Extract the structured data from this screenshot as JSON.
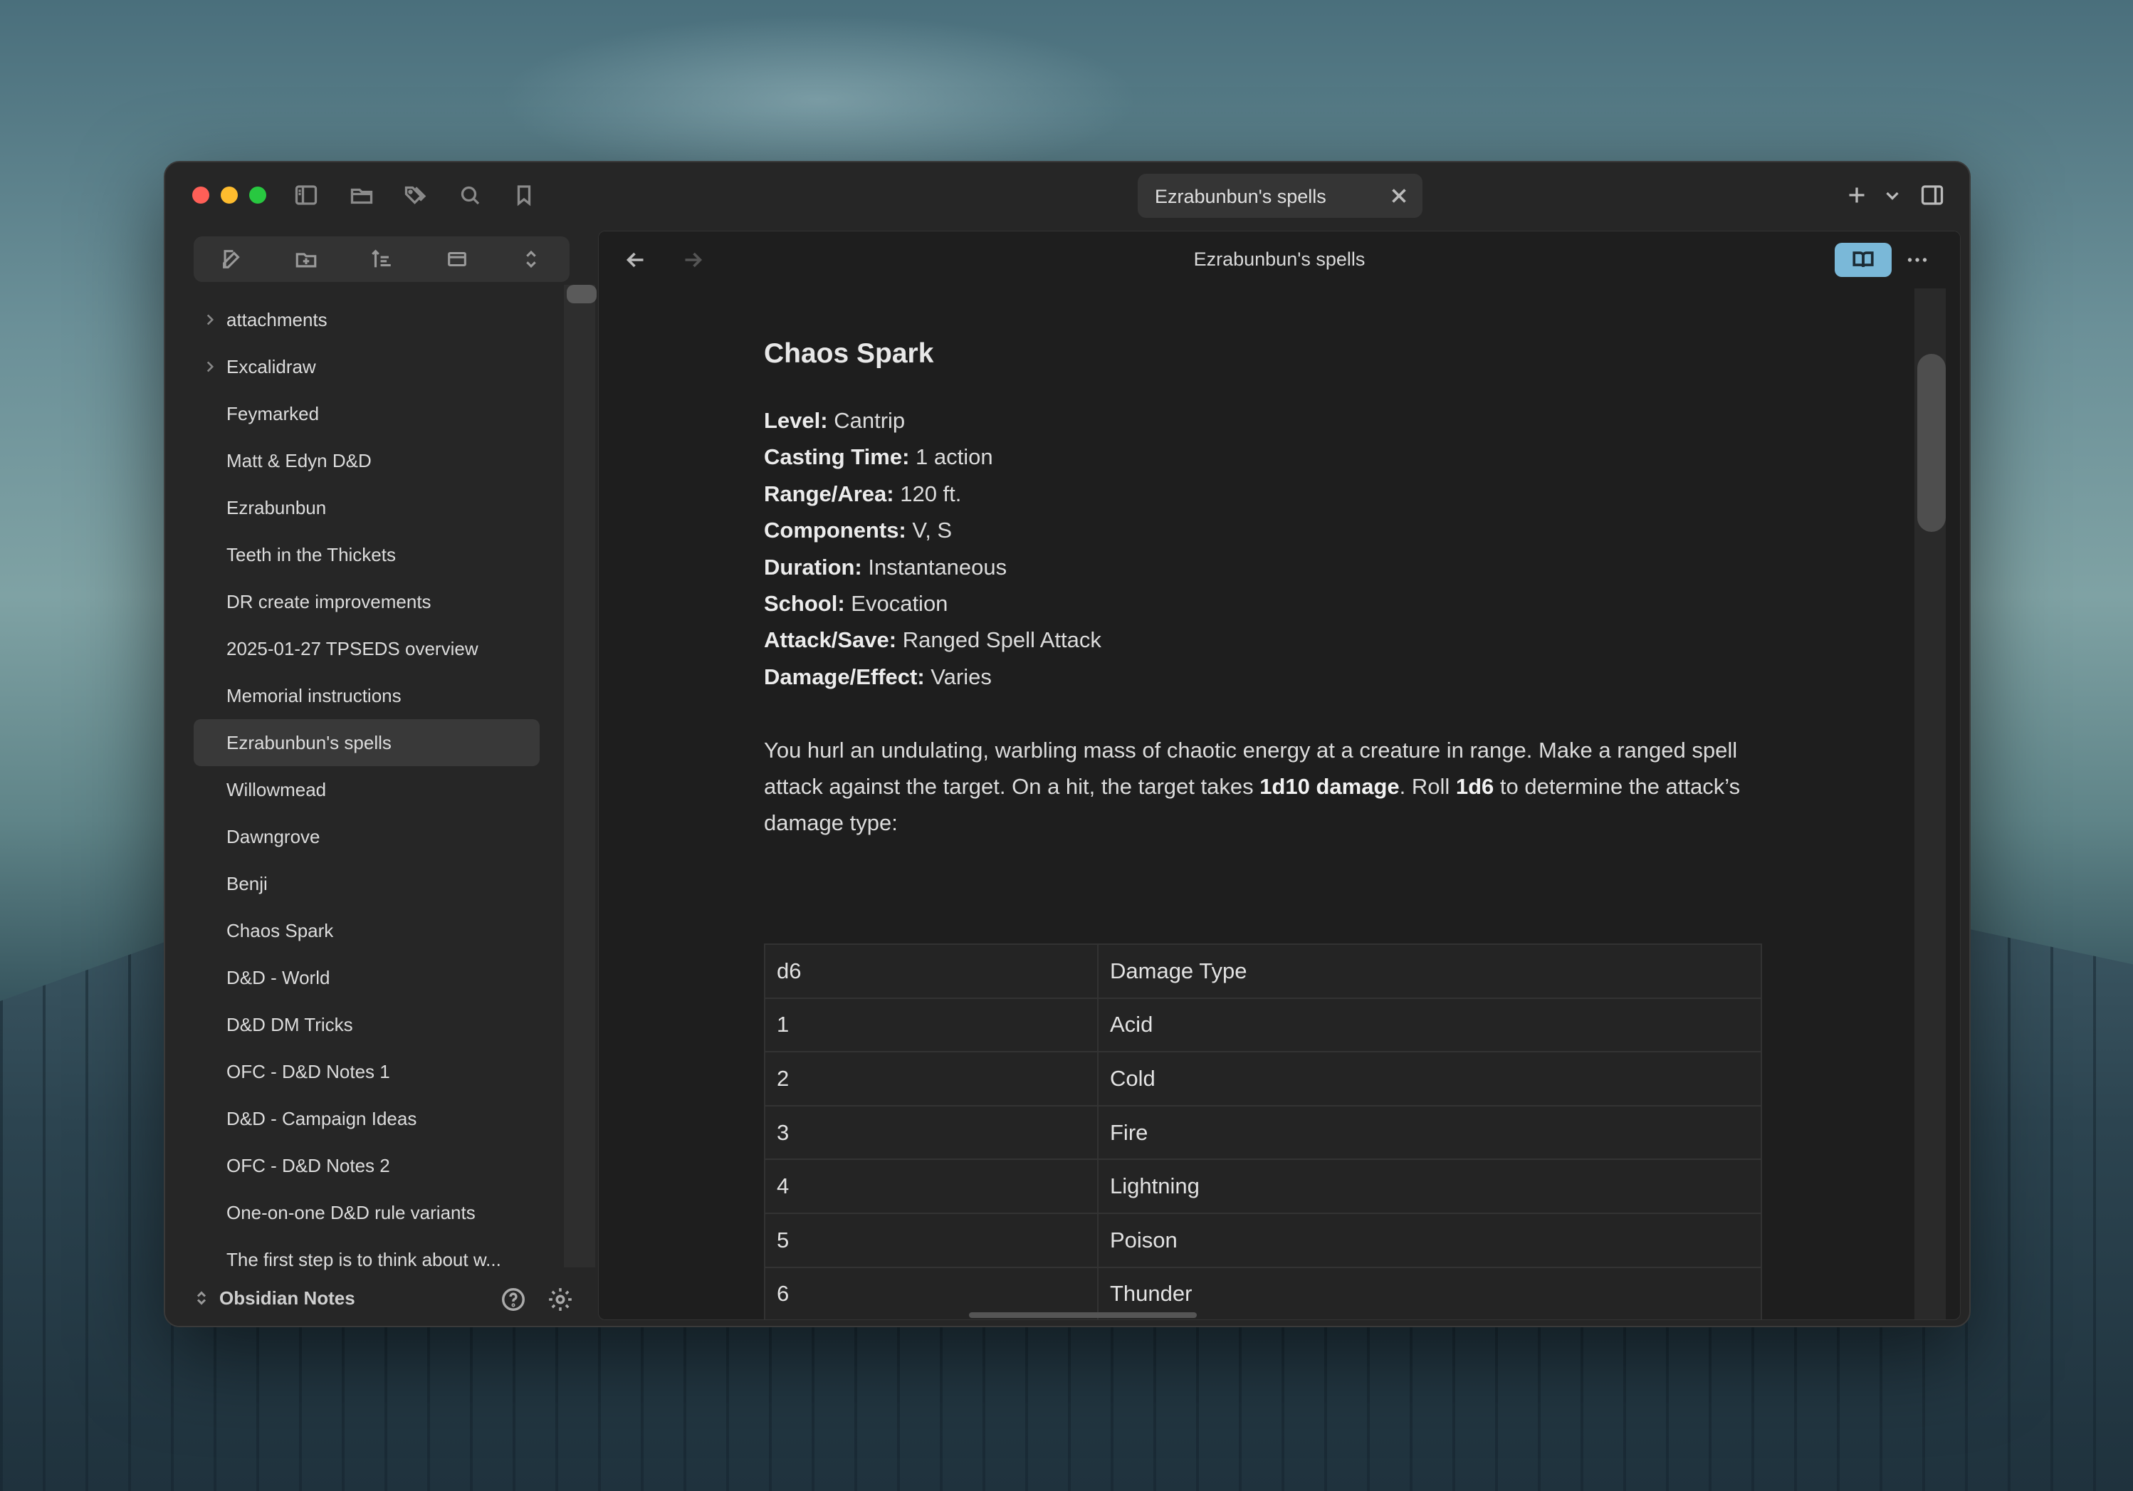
{
  "window": {
    "tab_title": "Ezrabunbun's spells"
  },
  "sidebar": {
    "files": [
      {
        "label": "attachments",
        "folder": true
      },
      {
        "label": "Excalidraw",
        "folder": true
      },
      {
        "label": "Feymarked"
      },
      {
        "label": "Matt & Edyn D&D"
      },
      {
        "label": "Ezrabunbun"
      },
      {
        "label": "Teeth in the Thickets"
      },
      {
        "label": "DR create improvements"
      },
      {
        "label": "2025-01-27 TPSEDS overview"
      },
      {
        "label": "Memorial instructions"
      },
      {
        "label": "Ezrabunbun's spells",
        "active": true
      },
      {
        "label": "Willowmead"
      },
      {
        "label": "Dawngrove"
      },
      {
        "label": "Benji"
      },
      {
        "label": "Chaos Spark"
      },
      {
        "label": "D&D - World"
      },
      {
        "label": "D&D DM Tricks"
      },
      {
        "label": "OFC - D&D Notes 1"
      },
      {
        "label": "D&D - Campaign Ideas"
      },
      {
        "label": "OFC - D&D Notes 2"
      },
      {
        "label": "One-on-one D&D rule variants"
      },
      {
        "label": "The first step is to think about w..."
      }
    ],
    "vault_name": "Obsidian Notes"
  },
  "main": {
    "header_title": "Ezrabunbun's spells",
    "heading": "Chaos Spark",
    "properties": [
      {
        "key": "Level:",
        "value": " Cantrip"
      },
      {
        "key": "Casting Time:",
        "value": " 1 action"
      },
      {
        "key": "Range/Area:",
        "value": " 120 ft."
      },
      {
        "key": "Components:",
        "value": " V, S"
      },
      {
        "key": "Duration:",
        "value": " Instantaneous"
      },
      {
        "key": "School:",
        "value": " Evocation"
      },
      {
        "key": "Attack/Save:",
        "value": " Ranged Spell Attack"
      },
      {
        "key": "Damage/Effect:",
        "value": " Varies"
      }
    ],
    "paragraph": {
      "part1": "You hurl an undulating, warbling mass of chaotic energy at a creature in range. Make a ranged spell attack against the target. On a hit, the target takes ",
      "bold1": "1d10 damage",
      "part2": ". Roll ",
      "bold2": "1d6",
      "part3": " to determine the attack’s damage type:"
    },
    "table": {
      "headers": [
        "d6",
        "Damage Type"
      ],
      "rows": [
        [
          "1",
          "Acid"
        ],
        [
          "2",
          "Cold"
        ],
        [
          "3",
          "Fire"
        ],
        [
          "4",
          "Lightning"
        ],
        [
          "5",
          "Poison"
        ],
        [
          "6",
          "Thunder"
        ]
      ]
    }
  },
  "icons": {
    "titlebar": [
      "sidebar-toggle-icon",
      "folder-icon",
      "tags-icon",
      "search-icon",
      "bookmark-icon"
    ],
    "sidebar_toolbar": [
      "new-note-icon",
      "new-folder-icon",
      "sort-icon",
      "collapse-all-icon",
      "expand-icon"
    ]
  },
  "colors": {
    "reading_mode_accent": "#7ab8d8",
    "active_item_bg": "#393939"
  }
}
